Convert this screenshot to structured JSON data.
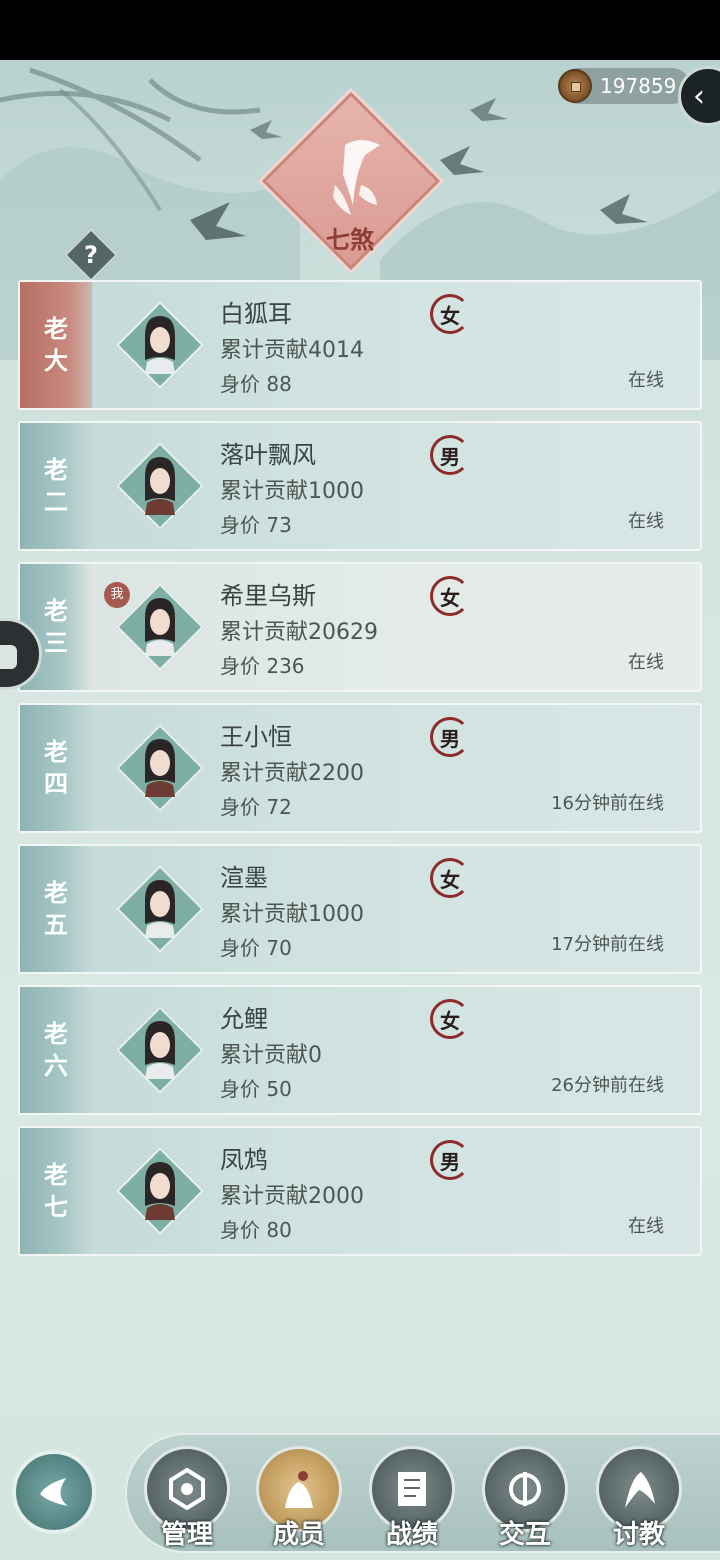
{
  "currency": {
    "value": "197859"
  },
  "emblem": {
    "title": "七煞"
  },
  "help": {
    "label": "?"
  },
  "members": [
    {
      "rank": [
        "老",
        "大"
      ],
      "name": "白狐耳",
      "gender": "女",
      "contribution": "累计贡献4014",
      "worth": "身价 88",
      "status": "在线",
      "is_leader": true,
      "is_self": false
    },
    {
      "rank": [
        "老",
        "二"
      ],
      "name": "落叶飘风",
      "gender": "男",
      "contribution": "累计贡献1000",
      "worth": "身价 73",
      "status": "在线",
      "is_leader": false,
      "is_self": false
    },
    {
      "rank": [
        "老",
        "三"
      ],
      "name": "希里乌斯",
      "gender": "女",
      "contribution": "累计贡献20629",
      "worth": "身价 236",
      "status": "在线",
      "is_leader": false,
      "is_self": true,
      "self_badge": "我"
    },
    {
      "rank": [
        "老",
        "四"
      ],
      "name": "王小恒",
      "gender": "男",
      "contribution": "累计贡献2200",
      "worth": "身价 72",
      "status": "16分钟前在线",
      "is_leader": false,
      "is_self": false
    },
    {
      "rank": [
        "老",
        "五"
      ],
      "name": "渲墨",
      "gender": "女",
      "contribution": "累计贡献1000",
      "worth": "身价 70",
      "status": "17分钟前在线",
      "is_leader": false,
      "is_self": false
    },
    {
      "rank": [
        "老",
        "六"
      ],
      "name": "允鲤",
      "gender": "女",
      "contribution": "累计贡献0",
      "worth": "身价 50",
      "status": "26分钟前在线",
      "is_leader": false,
      "is_self": false
    },
    {
      "rank": [
        "老",
        "七"
      ],
      "name": "凤鸩",
      "gender": "男",
      "contribution": "累计贡献2000",
      "worth": "身价 80",
      "status": "在线",
      "is_leader": false,
      "is_self": false
    }
  ],
  "nav": {
    "items": [
      {
        "label": "管理",
        "icon": "manage-icon",
        "active": false
      },
      {
        "label": "成员",
        "icon": "members-icon",
        "active": true
      },
      {
        "label": "战绩",
        "icon": "record-icon",
        "active": false
      },
      {
        "label": "交互",
        "icon": "interact-icon",
        "active": false
      },
      {
        "label": "讨教",
        "icon": "challenge-icon",
        "active": false
      }
    ]
  },
  "colors": {
    "leader_rank": "#b66f65",
    "accent_red": "#8e2a2a",
    "active_nav": "#c9a566"
  }
}
